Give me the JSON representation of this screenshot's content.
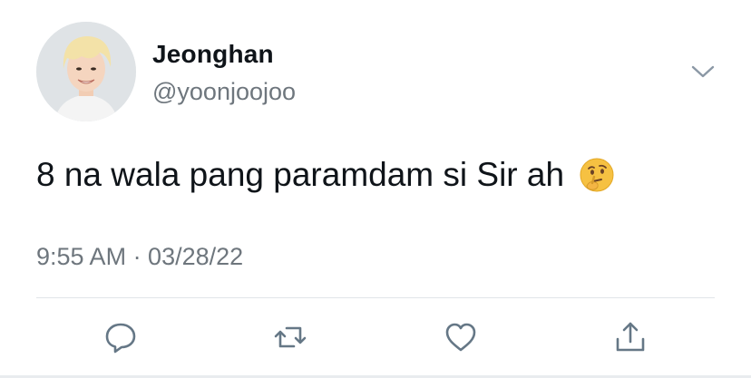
{
  "tweet": {
    "display_name": "Jeonghan",
    "handle": "@yoonjoojoo",
    "text": "8 na wala pang paramdam si Sir ah",
    "emoji_icon": "thinking-face-icon",
    "timestamp": "9:55 AM · 03/28/22"
  },
  "actions": [
    {
      "icon": "reply-icon"
    },
    {
      "icon": "retweet-icon"
    },
    {
      "icon": "like-icon"
    },
    {
      "icon": "share-icon"
    }
  ],
  "colors": {
    "text": "#0f1419",
    "secondary_text": "#6e767d",
    "icon": "#657786",
    "divider": "#e1e5e9",
    "emoji": "#f6c142"
  }
}
